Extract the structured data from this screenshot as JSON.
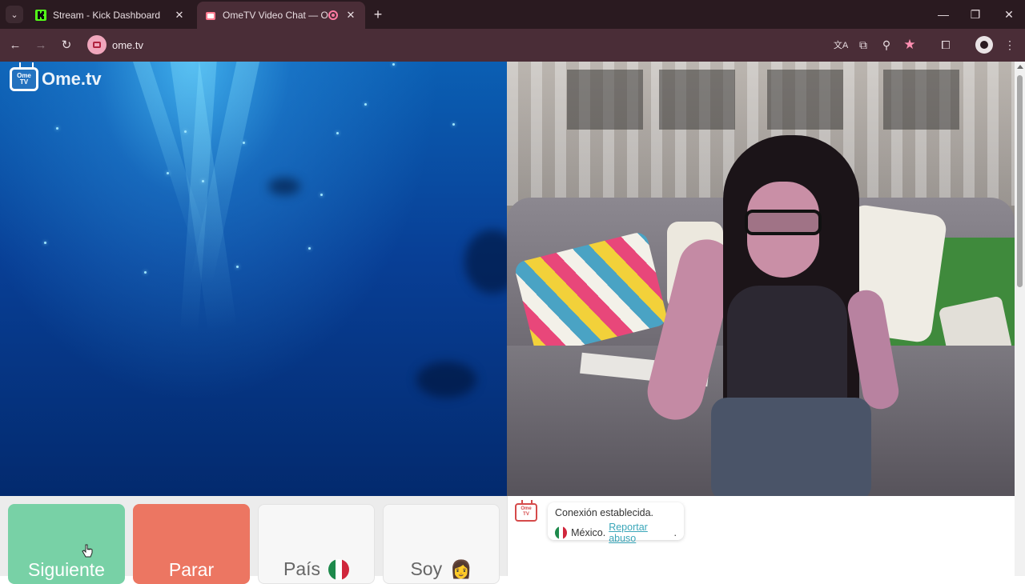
{
  "browser": {
    "tabs": [
      {
        "title": "Stream - Kick Dashboard",
        "favicon": "kick-icon",
        "active": false
      },
      {
        "title": "OmeTV Video Chat — Ome",
        "favicon": "ometv-icon",
        "active": true
      }
    ],
    "url": "ome.tv",
    "icons": {
      "back": "←",
      "forward": "→",
      "reload": "↻",
      "translate": "文A",
      "cast": "⧉",
      "zoom": "⚲",
      "bookmark": "★",
      "extensions": "⧠",
      "menu": "⋮",
      "minimize": "—",
      "maximize": "❐",
      "close": "✕",
      "new_tab": "+",
      "tab_search": "⌄"
    }
  },
  "page": {
    "logo": {
      "tv_text": "Ome\nTV",
      "brand": "Ome.tv"
    },
    "controls": {
      "next_label": "Siguiente",
      "stop_label": "Parar",
      "country_label": "País",
      "gender_label": "Soy",
      "gender_emoji": "👩"
    },
    "chat": {
      "tv_text": "Ome TV",
      "status": "Conexión establecida.",
      "country": "México.",
      "report_link": "Reportar abuso",
      "period": "."
    },
    "colors": {
      "next": "#78d1a6",
      "stop": "#ec7662",
      "link": "#3aa6b9",
      "chrome": "#4a2d37"
    }
  }
}
